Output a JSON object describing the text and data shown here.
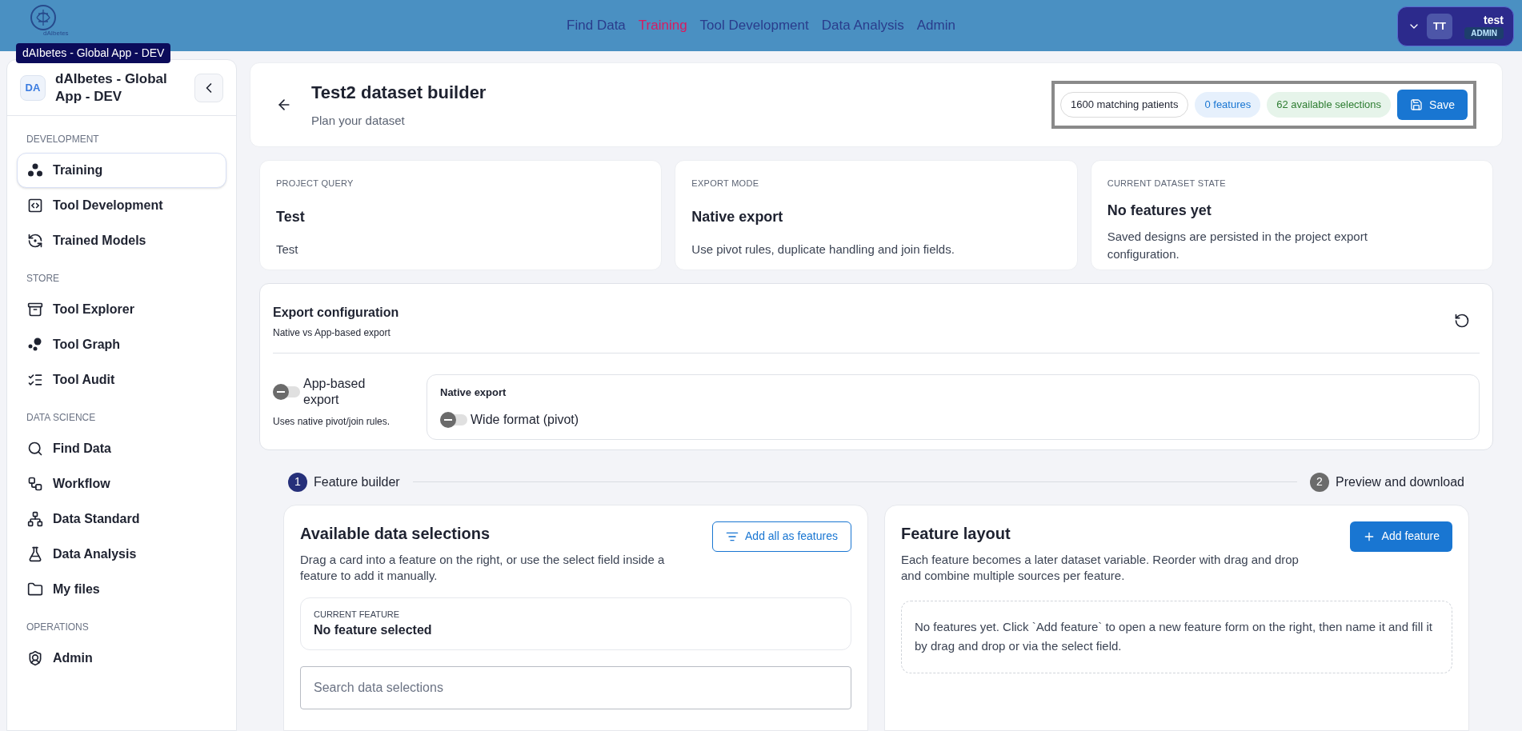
{
  "top_nav": {
    "logo_text": "dAIbetes",
    "tooltip": "dAIbetes - Global App - DEV",
    "links": [
      {
        "label": "Find Data",
        "selected": false
      },
      {
        "label": "Training",
        "selected": true
      },
      {
        "label": "Tool Development",
        "selected": false
      },
      {
        "label": "Data Analysis",
        "selected": false
      },
      {
        "label": "Admin",
        "selected": false
      }
    ],
    "user": {
      "initials": "TT",
      "name": "test",
      "role": "ADMIN"
    }
  },
  "sidebar": {
    "badge": "DA",
    "title": "dAIbetes - Global App - DEV",
    "sections": [
      {
        "heading": "DEVELOPMENT",
        "items": [
          {
            "label": "Training",
            "kind": "dots",
            "selected": true
          },
          {
            "label": "Tool Development",
            "kind": "code",
            "selected": false
          },
          {
            "label": "Trained Models",
            "kind": "cycle",
            "selected": false
          }
        ]
      },
      {
        "heading": "STORE",
        "items": [
          {
            "label": "Tool Explorer",
            "kind": "archive",
            "selected": false
          },
          {
            "label": "Tool Graph",
            "kind": "bubbles",
            "selected": false
          },
          {
            "label": "Tool Audit",
            "kind": "audit",
            "selected": false
          }
        ]
      },
      {
        "heading": "DATA SCIENCE",
        "items": [
          {
            "label": "Find Data",
            "kind": "search",
            "selected": false
          },
          {
            "label": "Workflow",
            "kind": "workflow",
            "selected": false
          },
          {
            "label": "Data Standard",
            "kind": "tree",
            "selected": false
          },
          {
            "label": "Data Analysis",
            "kind": "flask",
            "selected": false
          },
          {
            "label": "My files",
            "kind": "folder",
            "selected": false
          }
        ]
      },
      {
        "heading": "OPERATIONS",
        "items": [
          {
            "label": "Admin",
            "kind": "shield",
            "selected": false
          }
        ]
      }
    ]
  },
  "header": {
    "title": "Test2 dataset builder",
    "subtitle": "Plan your dataset",
    "badges": [
      {
        "label": "1600 matching patients",
        "kind": "neutral"
      },
      {
        "label": "0 features",
        "kind": "info"
      },
      {
        "label": "62 available selections",
        "kind": "success"
      }
    ],
    "save": "Save"
  },
  "info_cards": [
    {
      "label": "PROJECT QUERY",
      "title": "Test",
      "text": "Test"
    },
    {
      "label": "EXPORT MODE",
      "title": "Native export",
      "text": "Use pivot rules, duplicate handling and join fields."
    },
    {
      "label": "CURRENT DATASET STATE",
      "title": "No features yet",
      "text": "Saved designs are persisted in the project export configuration."
    }
  ],
  "export_config": {
    "title": "Export configuration",
    "subtitle": "Native vs App-based export",
    "app_toggle": {
      "label": "App-based export",
      "checked": false
    },
    "app_hint": "Uses native pivot/join rules.",
    "native": {
      "title": "Native export",
      "toggle": {
        "label": "Wide format (pivot)",
        "checked": false
      }
    }
  },
  "steps": [
    {
      "number": "1",
      "label": "Feature builder",
      "selected": true
    },
    {
      "number": "2",
      "label": "Preview and download",
      "selected": false
    }
  ],
  "available": {
    "title": "Available data selections",
    "text": "Drag a card into a feature on the right, or use the select field inside a feature to add it manually.",
    "button": "Add all as features",
    "current_label": "CURRENT FEATURE",
    "current_value": "No feature selected",
    "search": {
      "placeholder": "Search data selections"
    }
  },
  "layout": {
    "title": "Feature layout",
    "text": "Each feature becomes a later dataset variable. Reorder with drag and drop and combine multiple sources per feature.",
    "button": "Add feature",
    "empty": "No features yet. Click `Add feature` to open a new feature form on the right, then name it and fill it by drag and drop or via the select field."
  }
}
